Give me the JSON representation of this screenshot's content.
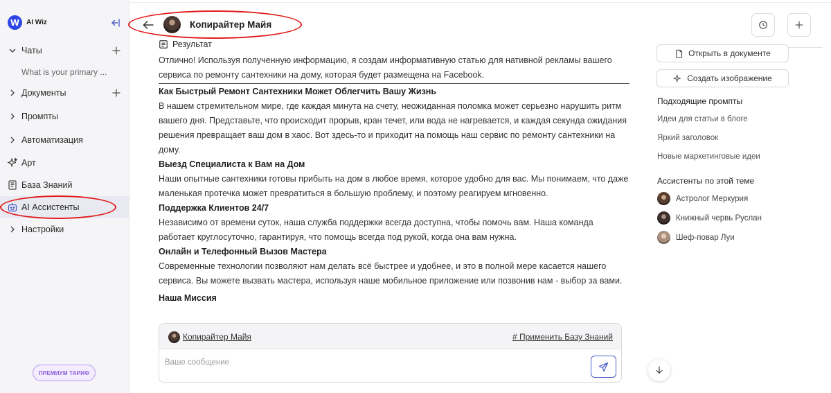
{
  "brand": {
    "name": "AI Wiz",
    "logo_letter": "W",
    "color": "#2d46e6"
  },
  "sidebar": {
    "items": [
      {
        "label": "Чаты",
        "icon": "chevron-right-icon",
        "has_add": true
      },
      {
        "label": "Документы",
        "icon": "chevron-right-icon",
        "has_add": true
      },
      {
        "label": "Промпты",
        "icon": "chevron-right-icon"
      },
      {
        "label": "Автоматизация",
        "icon": "chevron-right-icon"
      },
      {
        "label": "Арт",
        "icon": "sparkle-icon"
      },
      {
        "label": "База Знаний",
        "icon": "book-icon"
      },
      {
        "label": "AI Ассистенты",
        "icon": "robot-icon",
        "active": true
      },
      {
        "label": "Настройки",
        "icon": "chevron-right-icon"
      }
    ],
    "chat_preview": "What is your primary ...",
    "premium_label": "ПРЕМИУМ ТАРИФ"
  },
  "header": {
    "assistant_name": "Копирайтер Майя"
  },
  "result": {
    "heading": "Результат",
    "intro": "Отлично! Используя полученную информацию, я создам информативную статью для нативной рекламы вашего сервиса по ремонту сантехники на дому, которая будет размещена на Facebook.",
    "sections": [
      {
        "title": "Как Быстрый Ремонт Сантехники Может Облегчить Вашу Жизнь",
        "body": "В нашем стремительном мире, где каждая минута на счету, неожиданная поломка может серьезно нарушить ритм вашего дня. Представьте, что происходит прорыв, кран течет, или вода не нагревается, и каждая секунда ожидания решения превращает ваш дом в хаос. Вот здесь-то и приходит на помощь наш сервис по ремонту сантехники на дому."
      },
      {
        "title": "Выезд Специалиста к Вам на Дом",
        "body": "Наши опытные сантехники готовы прибыть на дом в любое время, которое удобно для вас. Мы понимаем, что даже маленькая протечка может превратиться в большую проблему, и поэтому реагируем мгновенно."
      },
      {
        "title": "Поддержка Клиентов 24/7",
        "body": "Независимо от времени суток, наша служба поддержки всегда доступна, чтобы помочь вам. Наша команда работает круглосуточно, гарантируя, что помощь всегда под рукой, когда она вам нужна."
      },
      {
        "title": "Онлайн и Телефонный Вызов Мастера",
        "body": "Современные технологии позволяют нам делать всё быстрее и удобнее, и это в полной мере касается нашего сервиса. Вы можете вызвать мастера, используя наше мобильное приложение или позвонив нам - выбор за вами."
      },
      {
        "title": "Наша Миссия",
        "body": ""
      }
    ]
  },
  "right_panel": {
    "open_doc": "Открыть в документе",
    "create_image": "Создать изображение",
    "prompts_heading": "Подходящие промпты",
    "prompts": [
      "Идеи для статьи в блоге",
      "Яркий заголовок",
      "Новые маркетинговые идеи"
    ],
    "assistants_heading": "Ассистенты по этой теме",
    "assistants": [
      "Астролог Меркурия",
      "Книжный червь Руслан",
      "Шеф-повар Луи"
    ]
  },
  "composer": {
    "assistant_name": "Копирайтер Майя",
    "knowledge_link": "# Применить Базу Знаний",
    "placeholder": "Ваше сообщение"
  },
  "colors": {
    "annotation": "#e11a1a",
    "accent": "#4a5ec9",
    "premium": "#8a5ad8"
  }
}
